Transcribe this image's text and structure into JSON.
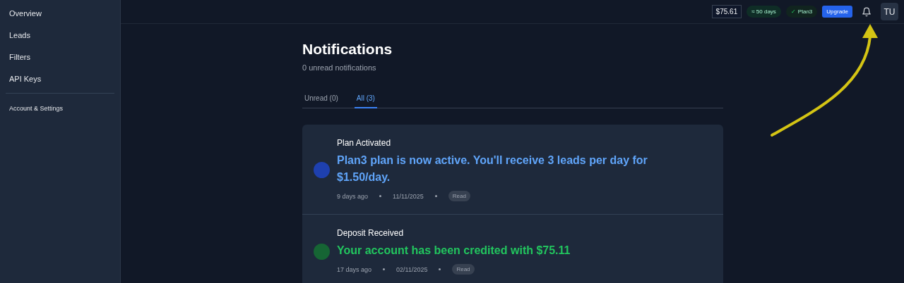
{
  "sidebar": {
    "items": [
      {
        "label": "Overview",
        "kind": "main"
      },
      {
        "label": "Leads",
        "kind": "main"
      },
      {
        "label": "Filters",
        "kind": "main"
      },
      {
        "label": "API Keys",
        "kind": "main"
      },
      {
        "label": "Account & Settings",
        "kind": "secondary"
      }
    ]
  },
  "topbar": {
    "balance": "$75.61",
    "days": "≈ 50 days",
    "plan_check": "✓",
    "plan": "Plan3",
    "upgrade": "Upgrade",
    "avatar": "TU"
  },
  "page": {
    "title": "Notifications",
    "subtitle": "0 unread notifications"
  },
  "tabs": [
    {
      "label": "Unread (0)",
      "selected": false
    },
    {
      "label": "All (3)",
      "selected": true
    }
  ],
  "notifications": [
    {
      "kind": "plan",
      "color": "#1e40af",
      "title": "Plan Activated",
      "message": "Plan3 plan is now active. You'll receive 3 leads per day for $1.50/day.",
      "ago": "9 days ago",
      "date": "11/11/2025",
      "status": "Read"
    },
    {
      "kind": "deposit",
      "color": "#166534",
      "title": "Deposit Received",
      "message": "Your account has been credited with $75.11",
      "ago": "17 days ago",
      "date": "02/11/2025",
      "status": "Read"
    }
  ],
  "annotation": {
    "kind": "arrow"
  }
}
